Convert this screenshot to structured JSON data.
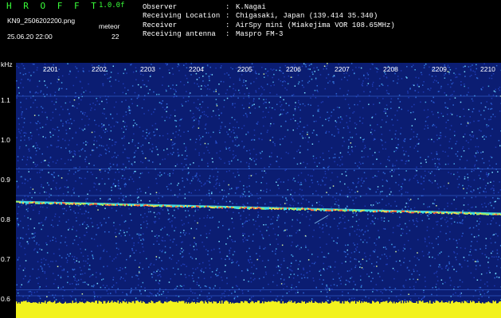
{
  "header": {
    "logo": "H R O F F T",
    "version": "1.0.0f",
    "filename": "KN9_2506202200.png",
    "meteor_label": "meteor",
    "datetime": "25.06.20 22:00",
    "count": "22"
  },
  "info": [
    {
      "label": "Observer",
      "value": "K.Nagai"
    },
    {
      "label": "Receiving Location",
      "value": "Chigasaki, Japan (139.414 35.340)"
    },
    {
      "label": "Receiver",
      "value": "AirSpy mini (Miakejima VOR 108.65MHz)"
    },
    {
      "label": "Receiving antenna",
      "value": "Maspro FM-3"
    }
  ],
  "chart_data": {
    "type": "heatmap",
    "ylabel": "kHz",
    "yticks": [
      "1.1",
      "1.0",
      "0.9",
      "0.8",
      "0.7",
      "0.6"
    ],
    "minutes": [
      "2201",
      "2202",
      "2203",
      "2204",
      "2205",
      "2206",
      "2207",
      "2208",
      "2209",
      "2210"
    ],
    "carrier_khz": {
      "start": 0.845,
      "end": 0.815
    },
    "background": "#0b1d72",
    "noise_colors": [
      "#1e3cb4",
      "#2f6ad8",
      "#47a8e6",
      "#7ae0ff",
      "#d6f2a0"
    ],
    "signal_colors": [
      "#48e6e2",
      "#a8f060",
      "#ffd84a",
      "#ff6a3a"
    ],
    "baseline_color": "#f2f21e"
  }
}
